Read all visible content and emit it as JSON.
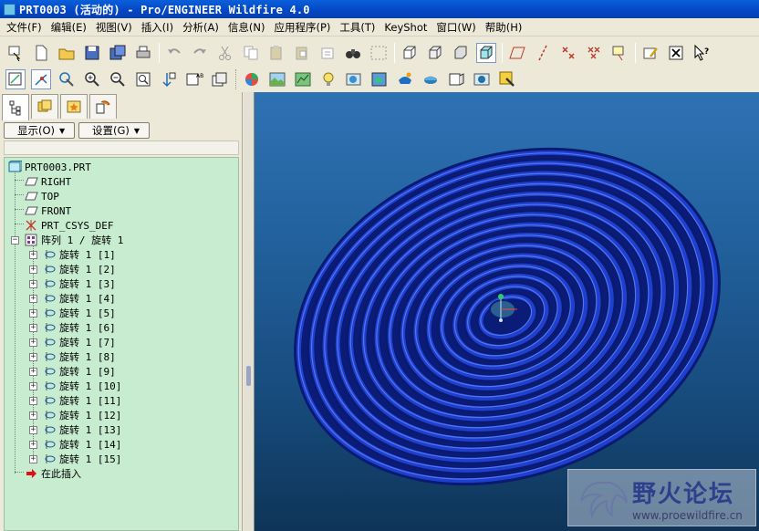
{
  "window": {
    "title": "PRT0003 (活动的) - Pro/ENGINEER Wildfire 4.0"
  },
  "menu": [
    "文件(F)",
    "编辑(E)",
    "视图(V)",
    "插入(I)",
    "分析(A)",
    "信息(N)",
    "应用程序(P)",
    "工具(T)",
    "KeyShot",
    "窗口(W)",
    "帮助(H)"
  ],
  "panel": {
    "show_button": "显示(O)",
    "settings_button": "设置(G)"
  },
  "tree": {
    "root": "PRT0003.PRT",
    "datums": [
      "RIGHT",
      "TOP",
      "FRONT",
      "PRT_CSYS_DEF"
    ],
    "pattern": "阵列 1 / 旋转 1",
    "items": [
      "旋转 1 [1]",
      "旋转 1 [2]",
      "旋转 1 [3]",
      "旋转 1 [4]",
      "旋转 1 [5]",
      "旋转 1 [6]",
      "旋转 1 [7]",
      "旋转 1 [8]",
      "旋转 1 [9]",
      "旋转 1 [10]",
      "旋转 1 [11]",
      "旋转 1 [12]",
      "旋转 1 [13]",
      "旋转 1 [14]",
      "旋转 1 [15]"
    ],
    "insert_here": "在此插入"
  },
  "watermark": {
    "title": "野火论坛",
    "url": "www.proewildfire.cn"
  },
  "colors": {
    "tree_bg": "#c7eccf",
    "viewport_top": "#2f72b4",
    "viewport_bottom": "#0e3458",
    "model_blue": "#1f3fd0"
  }
}
